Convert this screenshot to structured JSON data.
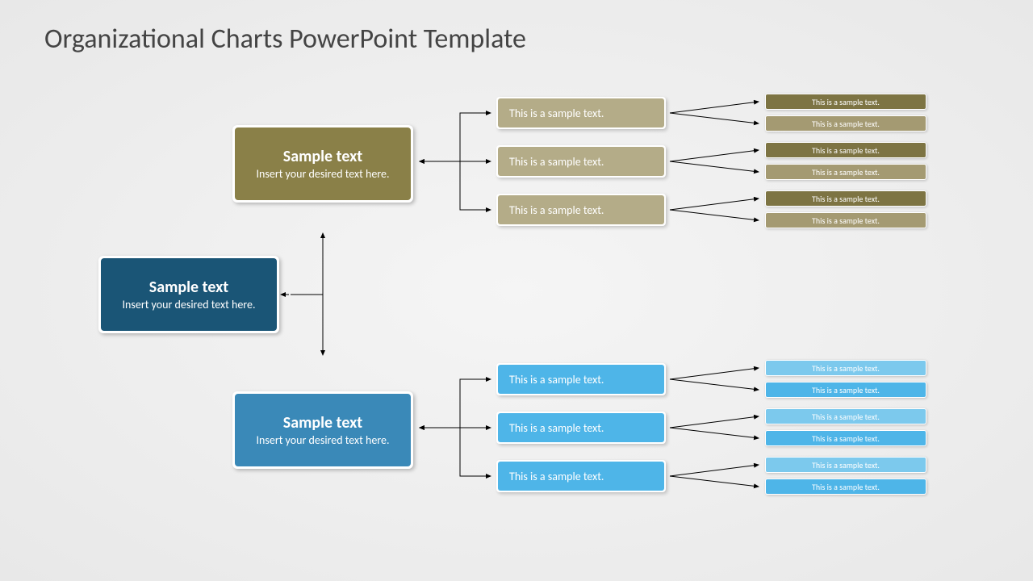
{
  "title": "Organizational Charts PowerPoint Template",
  "root": {
    "title": "Sample text",
    "sub": "Insert your desired text here."
  },
  "top": {
    "title": "Sample text",
    "sub": "Insert your desired text here."
  },
  "bot": {
    "title": "Sample text",
    "sub": "Insert your desired text here."
  },
  "mid": "This is a sample text.",
  "small": "This is a sample text."
}
